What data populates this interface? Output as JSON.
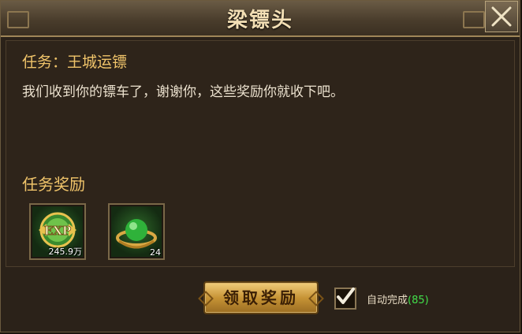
{
  "dialog": {
    "title": "梁镖头",
    "close_icon": "close-x-icon"
  },
  "task": {
    "title": "任务：王城运镖",
    "description": "我们收到你的镖车了，谢谢你，这些奖励你就收下吧。"
  },
  "rewards": {
    "heading": "任务奖励",
    "items": [
      {
        "icon": "exp-medal-icon",
        "count": "245.9万"
      },
      {
        "icon": "green-orb-icon",
        "count": "24"
      }
    ]
  },
  "actions": {
    "claim_label": "领取奖励",
    "auto_complete_checked": true,
    "auto_complete_label": "自动完成",
    "auto_complete_count": "(85)"
  }
}
